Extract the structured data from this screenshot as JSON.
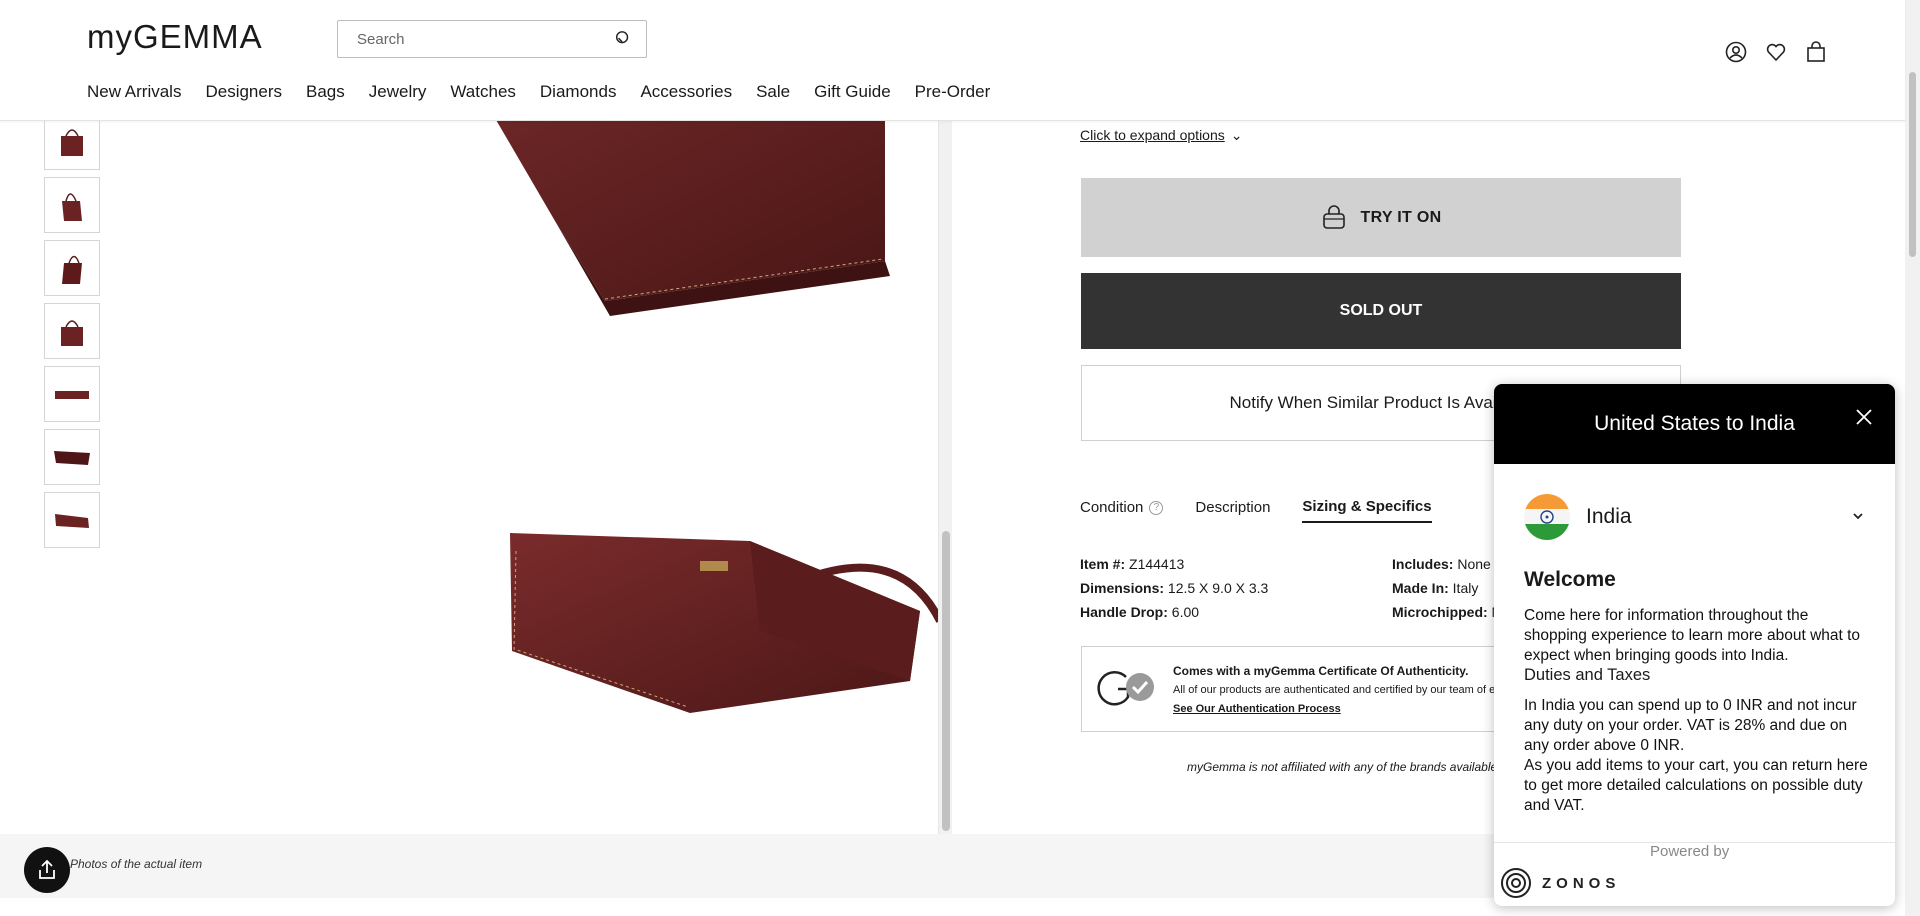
{
  "header": {
    "logo": "myGEMMA",
    "search_placeholder": "Search",
    "nav": [
      "New Arrivals",
      "Designers",
      "Bags",
      "Jewelry",
      "Watches",
      "Diamonds",
      "Accessories",
      "Sale",
      "Gift Guide",
      "Pre-Order"
    ]
  },
  "gallery": {
    "photo_note": "Photos of the actual item",
    "thumbnail_count": 7
  },
  "product": {
    "expand_options": "Click to expand options",
    "try_on": "TRY IT ON",
    "sold_out": "SOLD OUT",
    "notify": "Notify When Similar Product Is Available",
    "tabs": [
      {
        "label": "Condition",
        "active": false
      },
      {
        "label": "Description",
        "active": false
      },
      {
        "label": "Sizing & Specifics",
        "active": true
      }
    ],
    "specs_left": [
      {
        "label": "Item #:",
        "value": " Z144413"
      },
      {
        "label": "Dimensions:",
        "value": " 12.5 X 9.0 X 3.3"
      },
      {
        "label": "Handle Drop:",
        "value": " 6.00"
      }
    ],
    "specs_right": [
      {
        "label": "Includes:",
        "value": " None"
      },
      {
        "label": "Made In:",
        "value": " Italy"
      },
      {
        "label": "Microchipped:",
        "value": " No"
      }
    ],
    "cert_title": "Comes with a myGemma Certificate Of Authenticity.",
    "cert_text": "All of our products are authenticated and certified by our team of experts.",
    "cert_link": "See Our Authentication Process",
    "disclaimer": "myGemma is not affiliated with any of the brands available on our site."
  },
  "popup": {
    "title": "United States to India",
    "country": "India",
    "welcome": "Welcome",
    "p1": "Come here for information throughout the shopping experience to learn more about what to expect when bringing goods into India.",
    "duties": "Duties and Taxes",
    "p2": "In India you can spend up to 0 INR and not incur any duty on your order. VAT is 28% and due on any order above 0 INR.",
    "p3": "As you add items to your cart, you can return here to get more detailed calculations on possible duty and VAT.",
    "powered_by": "Powered by",
    "brand": "ZONOS"
  }
}
